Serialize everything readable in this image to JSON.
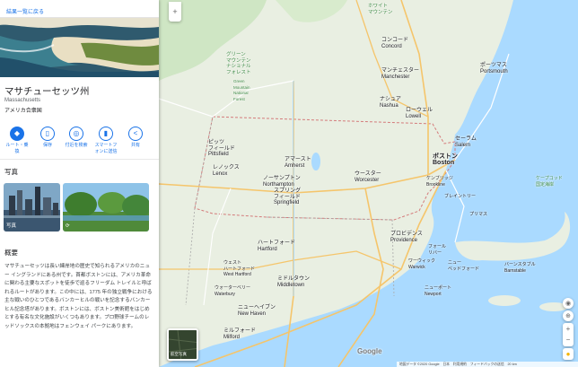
{
  "panel": {
    "back_label": "結果一覧に戻る",
    "title": "マサチューセッツ州",
    "subtitle": "Massachusetts",
    "country": "アメリカ合衆国",
    "actions": [
      {
        "label": "ルート・乗\n換",
        "icon": "directions-icon"
      },
      {
        "label": "保存",
        "icon": "bookmark-icon"
      },
      {
        "label": "付近を検索",
        "icon": "nearby-icon"
      },
      {
        "label": "スマートフ\nォンに送信",
        "icon": "phone-icon"
      },
      {
        "label": "共有",
        "icon": "share-icon"
      }
    ],
    "photos_heading": "写真",
    "photos": [
      {
        "caption": "写真"
      },
      {
        "caption": "360-icon"
      }
    ],
    "overview_heading": "概要",
    "overview_text": "マサチューセッツは長い練岸地の歴史で知られるアメリカのニュー イングランドにある州です。首都ボストンには、アメリカ革命に関わる主要なスポットを徒歩で巡るフリーダム トレイルと呼ばれるルートがあります。この中には、1775 年の独立戦争における主な戦いのひとつであるバンカーヒルの戦いを記念するバンカーヒル記念塔があります。ボストンには、ボストン美術館をはじめとする有名な文化施設がいくつもあります。プロ野球チームのレッドソックスの本拠地はフェンウェイ パークにあります。"
  },
  "map": {
    "zoom_in": "+",
    "zoom_out": "−",
    "layers_label": "航空写真",
    "google_logo": "Google",
    "footer_text": "地図データ ©2020 Google　日本　利用規約　フィードバックの送信　20 km",
    "labels": [
      {
        "text": "グリーン\nマウンテン\nナショナル\nフォレスト",
        "class": "green"
      },
      {
        "text": "Green\nMountain\nNational\nForest",
        "class": "green"
      },
      {
        "text": "ホワイト\nマウンテン",
        "class": "green"
      },
      {
        "text": "コンコード\nConcord",
        "class": "city"
      },
      {
        "text": "ポーツマス\nPortsmouth",
        "class": "city"
      },
      {
        "text": "マンチェスター\nManchester",
        "class": "city"
      },
      {
        "text": "ナシュア\nNashua",
        "class": "city"
      },
      {
        "text": "ローウェル\nLowell",
        "class": "city"
      },
      {
        "text": "セーラム\nSalem",
        "class": "city"
      },
      {
        "text": "ボストン\nBoston",
        "class": "big"
      },
      {
        "text": "ケンブリッジ\nBrookline",
        "class": "city"
      },
      {
        "text": "ピッツ\nフィールド\nPittsfield",
        "class": "city"
      },
      {
        "text": "レノックス\nLenox",
        "class": "city"
      },
      {
        "text": "アマースト\nAmherst",
        "class": "city"
      },
      {
        "text": "ノーサンプトン\nNorthampton",
        "class": "city"
      },
      {
        "text": "スプリング\nフィールド\nSpringfield",
        "class": "city"
      },
      {
        "text": "ウースター\nWorcester",
        "class": "city"
      },
      {
        "text": "プロビデンス\nProvidence",
        "class": "city"
      },
      {
        "text": "ハートフォード\nHartford",
        "class": "city"
      },
      {
        "text": "ウェスト\nハートフォード\nWest Hartford",
        "class": "city"
      },
      {
        "text": "ミドルタウン\nMiddletown",
        "class": "city"
      },
      {
        "text": "ウォーターベリー\nWaterbury",
        "class": "city"
      },
      {
        "text": "ニューヘイブン\nNew Haven",
        "class": "city"
      },
      {
        "text": "ミルフォード\nMilford",
        "class": "city"
      },
      {
        "text": "ワーウィック\nWarwick",
        "class": "city"
      },
      {
        "text": "ニューポート\nNewport",
        "class": "city"
      },
      {
        "text": "ニュー\nベッドフォード",
        "class": "city"
      },
      {
        "text": "バーンスタブル\nBarnstable",
        "class": "city"
      },
      {
        "text": "ケープコッド\n国定海岸",
        "class": "green"
      },
      {
        "text": "プリマス",
        "class": "city"
      },
      {
        "text": "フォール\nリバー",
        "class": "city"
      },
      {
        "text": "ブレイントリー",
        "class": "city"
      }
    ]
  }
}
